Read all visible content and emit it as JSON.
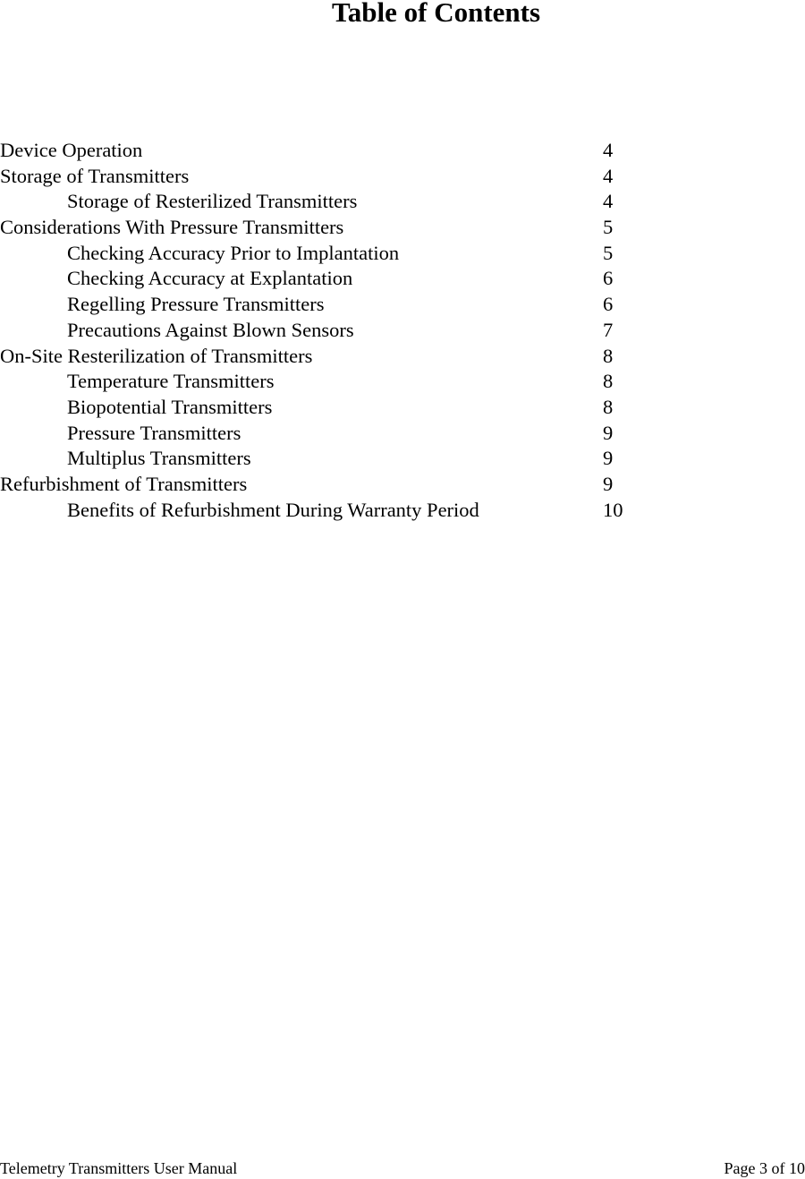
{
  "document": {
    "title": "Table of Contents",
    "toc": [
      {
        "label": "Device Operation",
        "page": "4",
        "level": 1
      },
      {
        "label": "Storage of Transmitters",
        "page": "4",
        "level": 1
      },
      {
        "label": "Storage of Resterilized Transmitters",
        "page": "4",
        "level": 2
      },
      {
        "label": "Considerations With Pressure Transmitters",
        "page": "5",
        "level": 1
      },
      {
        "label": "Checking Accuracy Prior to Implantation",
        "page": "5",
        "level": 2
      },
      {
        "label": "Checking Accuracy at Explantation",
        "page": "6",
        "level": 2
      },
      {
        "label": "Regelling Pressure Transmitters",
        "page": "6",
        "level": 2
      },
      {
        "label": "Precautions Against Blown Sensors",
        "page": "7",
        "level": 2
      },
      {
        "label": "On-Site Resterilization of Transmitters",
        "page": "8",
        "level": 1
      },
      {
        "label": "Temperature Transmitters",
        "page": "8",
        "level": 2
      },
      {
        "label": "Biopotential Transmitters",
        "page": "8",
        "level": 2
      },
      {
        "label": "Pressure Transmitters",
        "page": "9",
        "level": 2
      },
      {
        "label": "Multiplus Transmitters",
        "page": "9",
        "level": 2
      },
      {
        "label": "Refurbishment of Transmitters",
        "page": "9",
        "level": 1
      },
      {
        "label": "Benefits of Refurbishment During Warranty Period",
        "page": "10",
        "level": 2
      }
    ],
    "footer": {
      "left": "Telemetry Transmitters User Manual",
      "right": "Page 3 of 10"
    }
  }
}
